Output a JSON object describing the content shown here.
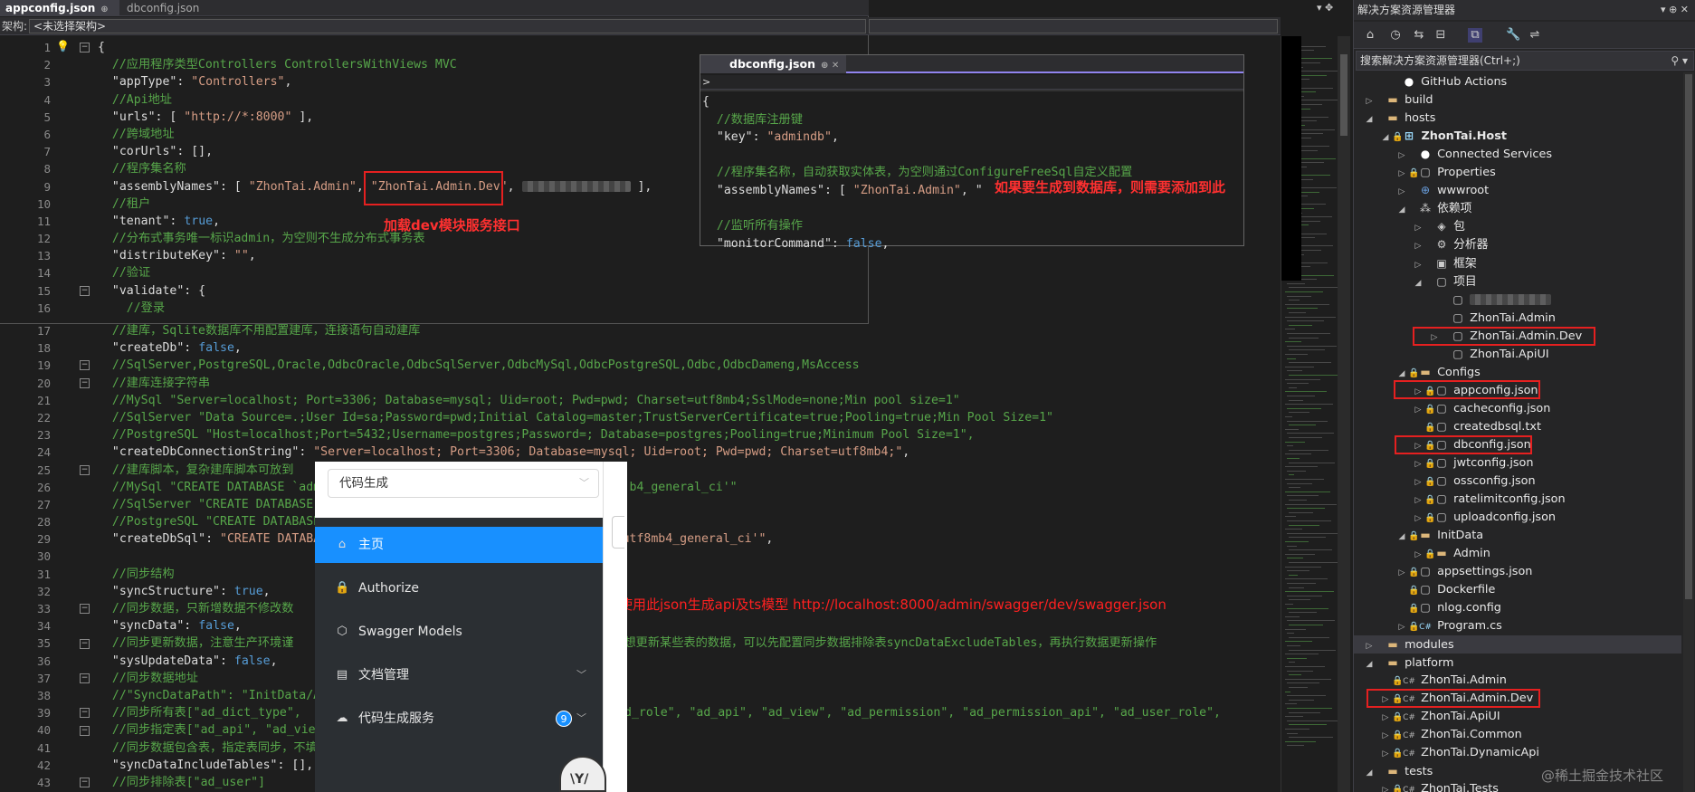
{
  "editor": {
    "active_tab": "appconfig.json",
    "inactive_tab": "dbconfig.json",
    "nav_label": "架构:",
    "nav_select": "<未选择架构>",
    "line_numbers": [
      "1",
      "2",
      "3",
      "4",
      "5",
      "6",
      "7",
      "8",
      "9",
      "10",
      "11",
      "12",
      "13",
      "14",
      "15",
      "16"
    ],
    "line_numbers_bottom": [
      "17",
      "18",
      "19",
      "20",
      "21",
      "22",
      "23",
      "24",
      "25",
      "26",
      "27",
      "28",
      "29",
      "30",
      "31",
      "32",
      "33",
      "34",
      "35",
      "36",
      "37",
      "38",
      "39",
      "40",
      "41",
      "42",
      "43"
    ],
    "top_lines": [
      {
        "t": "{",
        "c": "pun"
      },
      {
        "t": "  //应用程序类型Controllers ControllersWithViews MVC",
        "c": "cm"
      },
      {
        "t": "  \"appType\": \"Controllers\",",
        "c": "mix"
      },
      {
        "t": "  //Api地址",
        "c": "cm"
      },
      {
        "t": "  \"urls\": [ \"http://*:8000\" ],",
        "c": "mix"
      },
      {
        "t": "  //跨域地址",
        "c": "cm"
      },
      {
        "t": "  \"corUrls\": [],",
        "c": "key"
      },
      {
        "t": "  //程序集名称",
        "c": "cm"
      },
      {
        "t": "  \"assemblyNames\": [ \"ZhonTai.Admin\", \"ZhonTai.Admin.Dev\",",
        "c": "mix"
      },
      {
        "t": "  //租户",
        "c": "cm"
      },
      {
        "t": "  \"tenant\": true,",
        "c": "kwline"
      },
      {
        "t": "  //分布式事务唯一标识admin，为空则不生成分布式事务表",
        "c": "cm"
      },
      {
        "t": "  \"distributeKey\": \"\",",
        "c": "mix"
      },
      {
        "t": "  //验证",
        "c": "cm"
      },
      {
        "t": "  \"validate\": {",
        "c": "key"
      },
      {
        "t": "    //登录",
        "c": "cm"
      }
    ],
    "bottom_lines": [
      {
        "t": "  //建库，Sqlite数据库不用配置建库，连接语句自动建库",
        "c": "cm"
      },
      {
        "t": "  \"createDb\": false,",
        "c": "kwline"
      },
      {
        "t": "  //SqlServer,PostgreSQL,Oracle,OdbcOracle,OdbcSqlServer,OdbcMySql,OdbcPostgreSQL,Odbc,OdbcDameng,MsAccess",
        "c": "cm"
      },
      {
        "t": "  //建库连接字符串",
        "c": "cm"
      },
      {
        "t": "  //MySql \"Server=localhost; Port=3306; Database=mysql; Uid=root; Pwd=pwd; Charset=utf8mb4;SslMode=none;Min pool size=1\"",
        "c": "cm"
      },
      {
        "t": "  //SqlServer \"Data Source=.;User Id=sa;Password=pwd;Initial Catalog=master;TrustServerCertificate=true;Pooling=true;Min Pool Size=1\"",
        "c": "cm"
      },
      {
        "t": "  //PostgreSQL \"Host=localhost;Port=5432;Username=postgres;Password=; Database=postgres;Pooling=true;Minimum Pool Size=1\",",
        "c": "cm"
      },
      {
        "t": "  \"createDbConnectionString\": \"Server=localhost; Port=3306; Database=mysql; Uid=root; Pwd=pwd; Charset=utf8mb4;\",",
        "c": "mix"
      },
      {
        "t": "  //建库脚本，复杂建库脚本可放到",
        "c": "cm"
      },
      {
        "t": "  //MySql \"CREATE DATABASE `admi                                          b4_general_ci'\"",
        "c": "cm"
      },
      {
        "t": "  //SqlServer \"CREATE DATABASE",
        "c": "cm"
      },
      {
        "t": "  //PostgreSQL \"CREATE DATABASE",
        "c": "cm"
      },
      {
        "t": "  \"createDbSql\": \"CREATE DATABAS                                        'utf8mb4_general_ci'\",",
        "c": "mix"
      },
      {
        "t": "",
        "c": "pun"
      },
      {
        "t": "  //同步结构",
        "c": "cm"
      },
      {
        "t": "  \"syncStructure\": true,",
        "c": "kwline"
      },
      {
        "t": "  //同步数据，只新增数据不修改数",
        "c": "cm"
      },
      {
        "t": "  \"syncData\": false,",
        "c": "kwline"
      },
      {
        "t": "  //同步更新数据，注意生产环境谨                                         ，如不想更新某些表的数据，可以先配置同步数据排除表syncDataExcludeTables，再执行数据更新操作",
        "c": "cm"
      },
      {
        "t": "  \"sysUpdateData\": false,",
        "c": "kwline"
      },
      {
        "t": "  //同步数据地址",
        "c": "cm"
      },
      {
        "t": "  //\"SyncDataPath\": \"InitData/Ac",
        "c": "cm"
      },
      {
        "t": "  //同步所有表[\"ad_dict_type\",                                     org\", \"ad_role\", \"ad_api\", \"ad_view\", \"ad_permission\", \"ad_permission_api\", \"ad_user_role\",",
        "c": "cm"
      },
      {
        "t": "  //同步指定表[\"ad_api\", \"ad_view\", \"ad_permission\", \"ad_permission_api\"]",
        "c": "cm"
      },
      {
        "t": "  //同步数据包含表，指定表同步，不填同步所有表",
        "c": "cm"
      },
      {
        "t": "  \"syncDataIncludeTables\": [],",
        "c": "key"
      },
      {
        "t": "  //同步排除表[\"ad_user\"]",
        "c": "cm"
      }
    ]
  },
  "dbpanel": {
    "tab": "dbconfig.json",
    "nav": ">",
    "lines": [
      {
        "t": "{",
        "c": "pun"
      },
      {
        "t": "  //数据库注册键",
        "c": "cm"
      },
      {
        "t": "  \"key\": \"admindb\",",
        "c": "mix"
      },
      {
        "t": "",
        "c": "pun"
      },
      {
        "t": "  //程序集名称，自动获取实体表，为空则通过ConfigureFreeSql自定义配置",
        "c": "cm"
      },
      {
        "t": "  \"assemblyNames\": [ \"ZhonTai.Admin\", \"",
        "c": "mix"
      },
      {
        "t": "",
        "c": "pun"
      },
      {
        "t": "  //监听所有操作",
        "c": "cm"
      },
      {
        "t": "  \"monitorCommand\": false,",
        "c": "kwline"
      }
    ]
  },
  "annotations": {
    "dev_module": "加载dev模块服务接口",
    "db_note": "如果要生成到数据库，则需要添加到此",
    "swagger_note": "前台使用此json生成api及ts模型 http://localhost:8000/admin/swagger/dev/swagger.json"
  },
  "swagger": {
    "select_value": "代码生成",
    "menu": [
      {
        "label": "主页",
        "icon": "home-icon"
      },
      {
        "label": "Authorize",
        "icon": "lock-icon"
      },
      {
        "label": "Swagger Models",
        "icon": "cube-icon"
      },
      {
        "label": "文档管理",
        "icon": "doc-icon"
      },
      {
        "label": "代码生成服务",
        "icon": "cloud-icon",
        "badge": "9"
      }
    ],
    "mascot": "\\Y/"
  },
  "solution": {
    "title": "解决方案资源管理器",
    "search_placeholder": "搜索解决方案资源管理器(Ctrl+;)",
    "nodes": [
      {
        "label": "GitHub Actions",
        "depth": 1,
        "exp": "",
        "icon": "gh"
      },
      {
        "label": "build",
        "depth": 0,
        "exp": "▷",
        "icon": "folder"
      },
      {
        "label": "hosts",
        "depth": 0,
        "exp": "◢",
        "icon": "folder"
      },
      {
        "label": "ZhonTai.Host",
        "depth": 1,
        "exp": "◢",
        "icon": "proj",
        "bold": true,
        "lock": true
      },
      {
        "label": "Connected Services",
        "depth": 2,
        "exp": "▷",
        "icon": "gh"
      },
      {
        "label": "Properties",
        "depth": 2,
        "exp": "▷",
        "icon": "file",
        "lock": true
      },
      {
        "label": "wwwroot",
        "depth": 2,
        "exp": "▷",
        "icon": "web"
      },
      {
        "label": "依赖项",
        "depth": 2,
        "exp": "◢",
        "icon": "dep"
      },
      {
        "label": "包",
        "depth": 3,
        "exp": "▷",
        "icon": "pkg"
      },
      {
        "label": "分析器",
        "depth": 3,
        "exp": "▷",
        "icon": "ana"
      },
      {
        "label": "框架",
        "depth": 3,
        "exp": "▷",
        "icon": "fw"
      },
      {
        "label": "项目",
        "depth": 3,
        "exp": "◢",
        "icon": "file"
      },
      {
        "label": "",
        "depth": 4,
        "exp": "",
        "icon": "file",
        "blur": true
      },
      {
        "label": "ZhonTai.Admin",
        "depth": 4,
        "exp": "",
        "icon": "file"
      },
      {
        "label": "ZhonTai.Admin.Dev",
        "depth": 4,
        "exp": "▷",
        "icon": "file"
      },
      {
        "label": "ZhonTai.ApiUI",
        "depth": 4,
        "exp": "",
        "icon": "file"
      },
      {
        "label": "Configs",
        "depth": 2,
        "exp": "◢",
        "icon": "folder",
        "lock": true
      },
      {
        "label": "appconfig.json",
        "depth": 3,
        "exp": "▷",
        "icon": "file",
        "lock": true
      },
      {
        "label": "cacheconfig.json",
        "depth": 3,
        "exp": "▷",
        "icon": "file",
        "lock": true
      },
      {
        "label": "createdbsql.txt",
        "depth": 3,
        "exp": "",
        "icon": "file",
        "lock": true
      },
      {
        "label": "dbconfig.json",
        "depth": 3,
        "exp": "▷",
        "icon": "file",
        "lock": true
      },
      {
        "label": "jwtconfig.json",
        "depth": 3,
        "exp": "▷",
        "icon": "file",
        "lock": true
      },
      {
        "label": "ossconfig.json",
        "depth": 3,
        "exp": "▷",
        "icon": "file",
        "lock": true
      },
      {
        "label": "ratelimitconfig.json",
        "depth": 3,
        "exp": "▷",
        "icon": "file",
        "lock": true
      },
      {
        "label": "uploadconfig.json",
        "depth": 3,
        "exp": "▷",
        "icon": "file",
        "lock": true
      },
      {
        "label": "InitData",
        "depth": 2,
        "exp": "◢",
        "icon": "folder",
        "lock": true
      },
      {
        "label": "Admin",
        "depth": 3,
        "exp": "▷",
        "icon": "folder",
        "lock": true
      },
      {
        "label": "appsettings.json",
        "depth": 2,
        "exp": "▷",
        "icon": "file",
        "lock": true
      },
      {
        "label": "Dockerfile",
        "depth": 2,
        "exp": "",
        "icon": "file",
        "lock": true
      },
      {
        "label": "nlog.config",
        "depth": 2,
        "exp": "",
        "icon": "file",
        "lock": true
      },
      {
        "label": "Program.cs",
        "depth": 2,
        "exp": "▷",
        "icon": "cs",
        "lock": true
      },
      {
        "label": "modules",
        "depth": 0,
        "exp": "▷",
        "icon": "folder",
        "highlight": true
      },
      {
        "label": "platform",
        "depth": 0,
        "exp": "◢",
        "icon": "folder"
      },
      {
        "label": "ZhonTai.Admin",
        "depth": 1,
        "exp": "",
        "icon": "csproj",
        "lock": true
      },
      {
        "label": "ZhonTai.Admin.Dev",
        "depth": 1,
        "exp": "▷",
        "icon": "csproj",
        "lock": true
      },
      {
        "label": "ZhonTai.ApiUI",
        "depth": 1,
        "exp": "▷",
        "icon": "csproj",
        "lock": true
      },
      {
        "label": "ZhonTai.Common",
        "depth": 1,
        "exp": "▷",
        "icon": "csproj",
        "lock": true
      },
      {
        "label": "ZhonTai.DynamicApi",
        "depth": 1,
        "exp": "▷",
        "icon": "csproj",
        "lock": true
      },
      {
        "label": "tests",
        "depth": 0,
        "exp": "◢",
        "icon": "folder"
      },
      {
        "label": "ZhonTai.Tests",
        "depth": 1,
        "exp": "▷",
        "icon": "csproj",
        "lock": true
      }
    ]
  },
  "watermark": "@稀土掘金技术社区",
  "colors": {
    "accent": "#1890ff",
    "annotation": "#e52020",
    "tab_accent": "#9184ee"
  }
}
